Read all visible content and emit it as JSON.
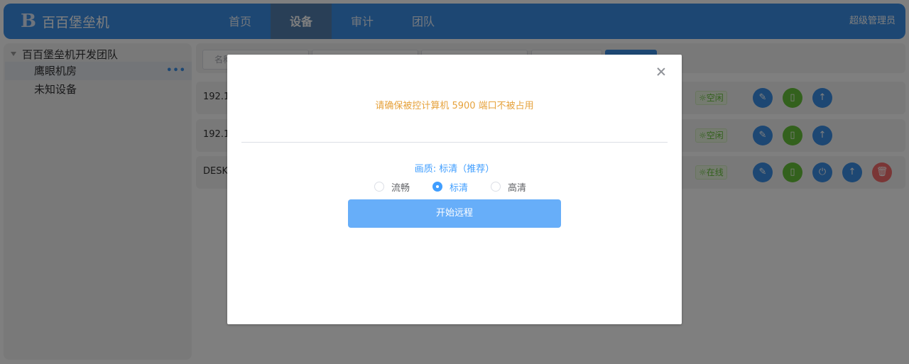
{
  "header": {
    "logo_mark": "B",
    "logo_text": "百百堡垒机",
    "nav": [
      "首页",
      "设备",
      "审计",
      "团队"
    ],
    "active_nav": "设备",
    "user": "超级管理员"
  },
  "sidebar": {
    "root": "百百堡垒机开发团队",
    "items": [
      {
        "label": "鹰眼机房",
        "selected": true
      },
      {
        "label": "未知设备",
        "selected": false
      }
    ],
    "more": "•••"
  },
  "filters": {
    "name_placeholder": "名称"
  },
  "devices": [
    {
      "name": "192.1",
      "status": "☼空闲"
    },
    {
      "name": "192.1",
      "status": "☼空闲"
    },
    {
      "name": "DESK",
      "status": "☼在线"
    }
  ],
  "dialog": {
    "warning": "请确保被控计算机 5900 端口不被占用",
    "quality_label": "画质: 标清（推荐）",
    "options": [
      "流畅",
      "标清",
      "高清"
    ],
    "selected_option": "标清",
    "start_button": "开始远程"
  },
  "colors": {
    "primary": "#3a8ee6",
    "warning": "#e6a23c",
    "success": "#67c23a",
    "danger": "#f56c6c",
    "button_light": "#67aef9"
  }
}
